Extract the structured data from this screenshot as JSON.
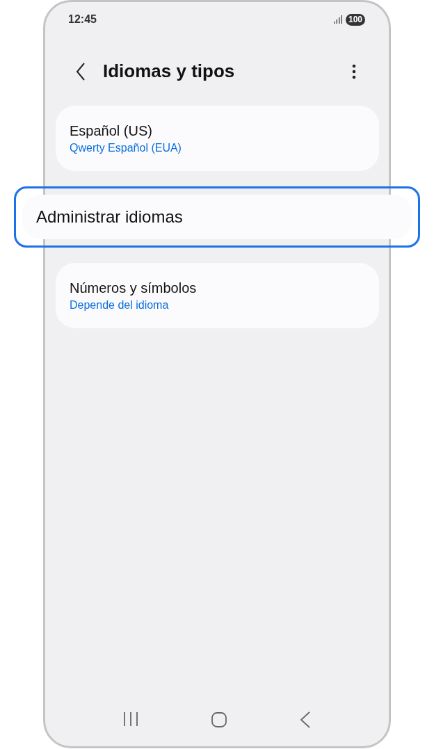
{
  "status_bar": {
    "time": "12:45",
    "battery": "100"
  },
  "header": {
    "title": "Idiomas y tipos"
  },
  "items": [
    {
      "title": "Español (US)",
      "subtitle": "Qwerty Español (EUA)",
      "highlighted": false
    },
    {
      "title": "Administrar idiomas",
      "highlighted": true
    },
    {
      "title": "Números y símbolos",
      "subtitle": "Depende del idioma",
      "highlighted": false
    }
  ]
}
